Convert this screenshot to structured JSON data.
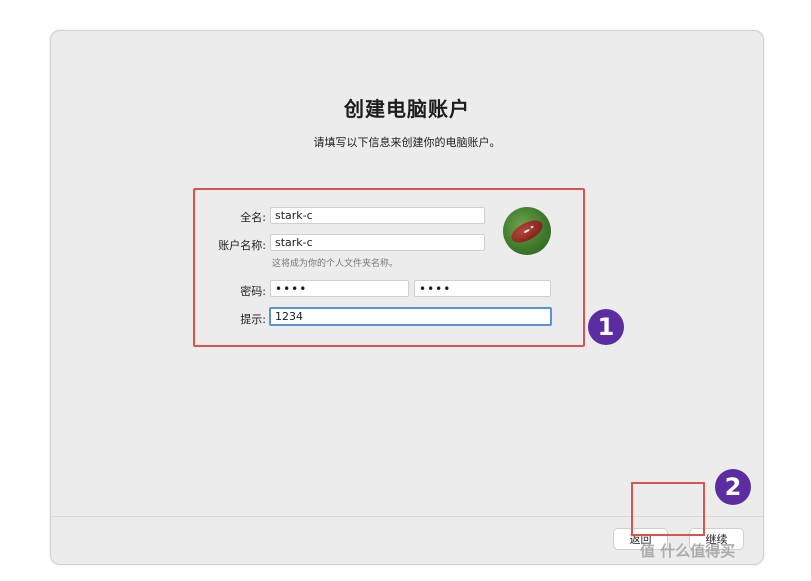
{
  "window": {
    "title": "创建电脑账户",
    "subtitle": "请填写以下信息来创建你的电脑账户。"
  },
  "form": {
    "fullname_label": "全名:",
    "fullname_value": "stark-c",
    "account_label": "账户名称:",
    "account_value": "stark-c",
    "account_hint": "这将成为你的个人文件夹名称。",
    "password_label": "密码:",
    "password_value": "••••",
    "verify_value": "••••",
    "hint_label": "提示:",
    "hint_value": "1234"
  },
  "buttons": {
    "back_label": "返回",
    "continue_label": "继续"
  },
  "annotations": {
    "badge1": "1",
    "badge2": "2"
  },
  "watermark": {
    "text": "值 什么值得买"
  },
  "colors": {
    "highlight_box": "#d9534f",
    "badge": "#5b2da0",
    "focus_ring": "#5b93d8"
  }
}
